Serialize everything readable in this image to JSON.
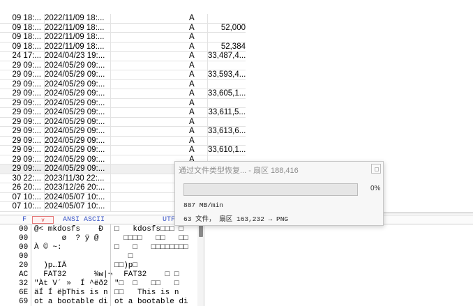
{
  "file_table": {
    "rows": [
      {
        "created": "09 18:...",
        "modified": "2022/11/09 18:...",
        "attr": "A",
        "size": ""
      },
      {
        "created": "09 18:...",
        "modified": "2022/11/09 18:...",
        "attr": "A",
        "size": "52,000"
      },
      {
        "created": "09 18:...",
        "modified": "2022/11/09 18:...",
        "attr": "A",
        "size": ""
      },
      {
        "created": "09 18:...",
        "modified": "2022/11/09 18:...",
        "attr": "A",
        "size": "52,384"
      },
      {
        "created": "24 17:...",
        "modified": "2024/04/23 19:...",
        "attr": "A",
        "size": "33,487,4..."
      },
      {
        "created": "29 09:...",
        "modified": "2024/05/29 09:...",
        "attr": "A",
        "size": ""
      },
      {
        "created": "29 09:...",
        "modified": "2024/05/29 09:...",
        "attr": "A",
        "size": "33,593,4..."
      },
      {
        "created": "29 09:...",
        "modified": "2024/05/29 09:...",
        "attr": "A",
        "size": ""
      },
      {
        "created": "29 09:...",
        "modified": "2024/05/29 09:...",
        "attr": "A",
        "size": "33,605,1..."
      },
      {
        "created": "29 09:...",
        "modified": "2024/05/29 09:...",
        "attr": "A",
        "size": ""
      },
      {
        "created": "29 09:...",
        "modified": "2024/05/29 09:...",
        "attr": "A",
        "size": "33,611,5..."
      },
      {
        "created": "29 09:...",
        "modified": "2024/05/29 09:...",
        "attr": "A",
        "size": ""
      },
      {
        "created": "29 09:...",
        "modified": "2024/05/29 09:...",
        "attr": "A",
        "size": "33,613,6..."
      },
      {
        "created": "29 09:...",
        "modified": "2024/05/29 09:...",
        "attr": "A",
        "size": ""
      },
      {
        "created": "29 09:...",
        "modified": "2024/05/29 09:...",
        "attr": "A",
        "size": "33,610,1..."
      },
      {
        "created": "29 09:...",
        "modified": "2024/05/29 09:...",
        "attr": "A",
        "size": ""
      },
      {
        "created": "29 09:...",
        "modified": "2024/05/29 09:...",
        "attr": "A",
        "size": ""
      },
      {
        "created": "30 22:...",
        "modified": "2023/11/30 22:...",
        "attr": "",
        "size": ""
      },
      {
        "created": "26 20:...",
        "modified": "2023/12/26 20:...",
        "attr": "",
        "size": ""
      },
      {
        "created": "07 10:...",
        "modified": "2024/05/07 10:...",
        "attr": "",
        "size": ""
      },
      {
        "created": "07 10:...",
        "modified": "2024/05/07 10:...",
        "attr": "",
        "size": ""
      }
    ]
  },
  "hex_panel": {
    "header": {
      "offset_col": "F",
      "ansi_label": "ANSI ASCII",
      "utf_label": "UTF",
      "tab_label": "v"
    },
    "lines": [
      {
        "off": "00",
        "ansi": "@< mkdosfs    Đ",
        "utf": "□   kdosfs□□□ □"
      },
      {
        "off": "00",
        "ansi": "      ø  ? ÿ @",
        "utf": "  □□□□   □□   □□"
      },
      {
        "off": "00",
        "ansi": "À © ~:",
        "utf": "□   □   □□□□□□□□"
      },
      {
        "off": "00",
        "ansi": "",
        "utf": "   □"
      },
      {
        "off": "20",
        "ansi": "  )p…IÄ",
        "utf": "□□)p□"
      },
      {
        "off": "AC",
        "ansi": "  FAT32      ¾w|¬",
        "utf": "  FAT32    □ □"
      },
      {
        "off": "32",
        "ansi": "\"Àt V´ »  Í ^ëð2",
        "utf": "\"□  □   □□   □"
      },
      {
        "off": "6E",
        "ansi": "äÍ Í ëþThis is n",
        "utf": "□□   This is n"
      },
      {
        "off": "69",
        "ansi": "ot a bootable di",
        "utf": "ot a bootable di"
      }
    ]
  },
  "progress_dialog": {
    "title": "通过文件类型恢复... - 扇区 188,416",
    "progress_fraction": 0.0,
    "progress_label": "0%",
    "speed": "887 MB/min",
    "status": "63 文件， 扇区 163,232 → PNG",
    "fill_color": "#06b025"
  }
}
